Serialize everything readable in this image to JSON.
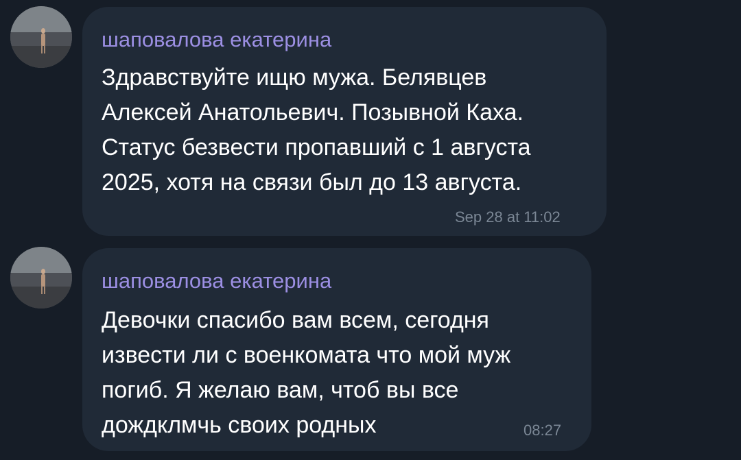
{
  "messages": [
    {
      "sender": "шаповалова екатерина",
      "text": "Здравствуйте ищю мужа. Белявцев\nАлексей Анатольевич. Позывной Каха.\nСтатус безвести пропавший с 1 августа\n2025, хотя на связи был до 13 августа.",
      "time": "Sep 28 at 11:02"
    },
    {
      "sender": "шаповалова екатерина",
      "text": "Девочки спасибо вам всем, сегодня\nизвести ли с военкомата что мой муж\nпогиб. Я желаю вам, чтоб вы все\nдождклмчь своих родных",
      "time": "08:27"
    }
  ],
  "colors": {
    "background": "#161d27",
    "bubble": "#202a37",
    "sender_name": "#9c8fe3",
    "message_text": "#ffffff",
    "timestamp": "#7b8795"
  },
  "icons": {
    "avatar": "user-avatar-photo"
  }
}
